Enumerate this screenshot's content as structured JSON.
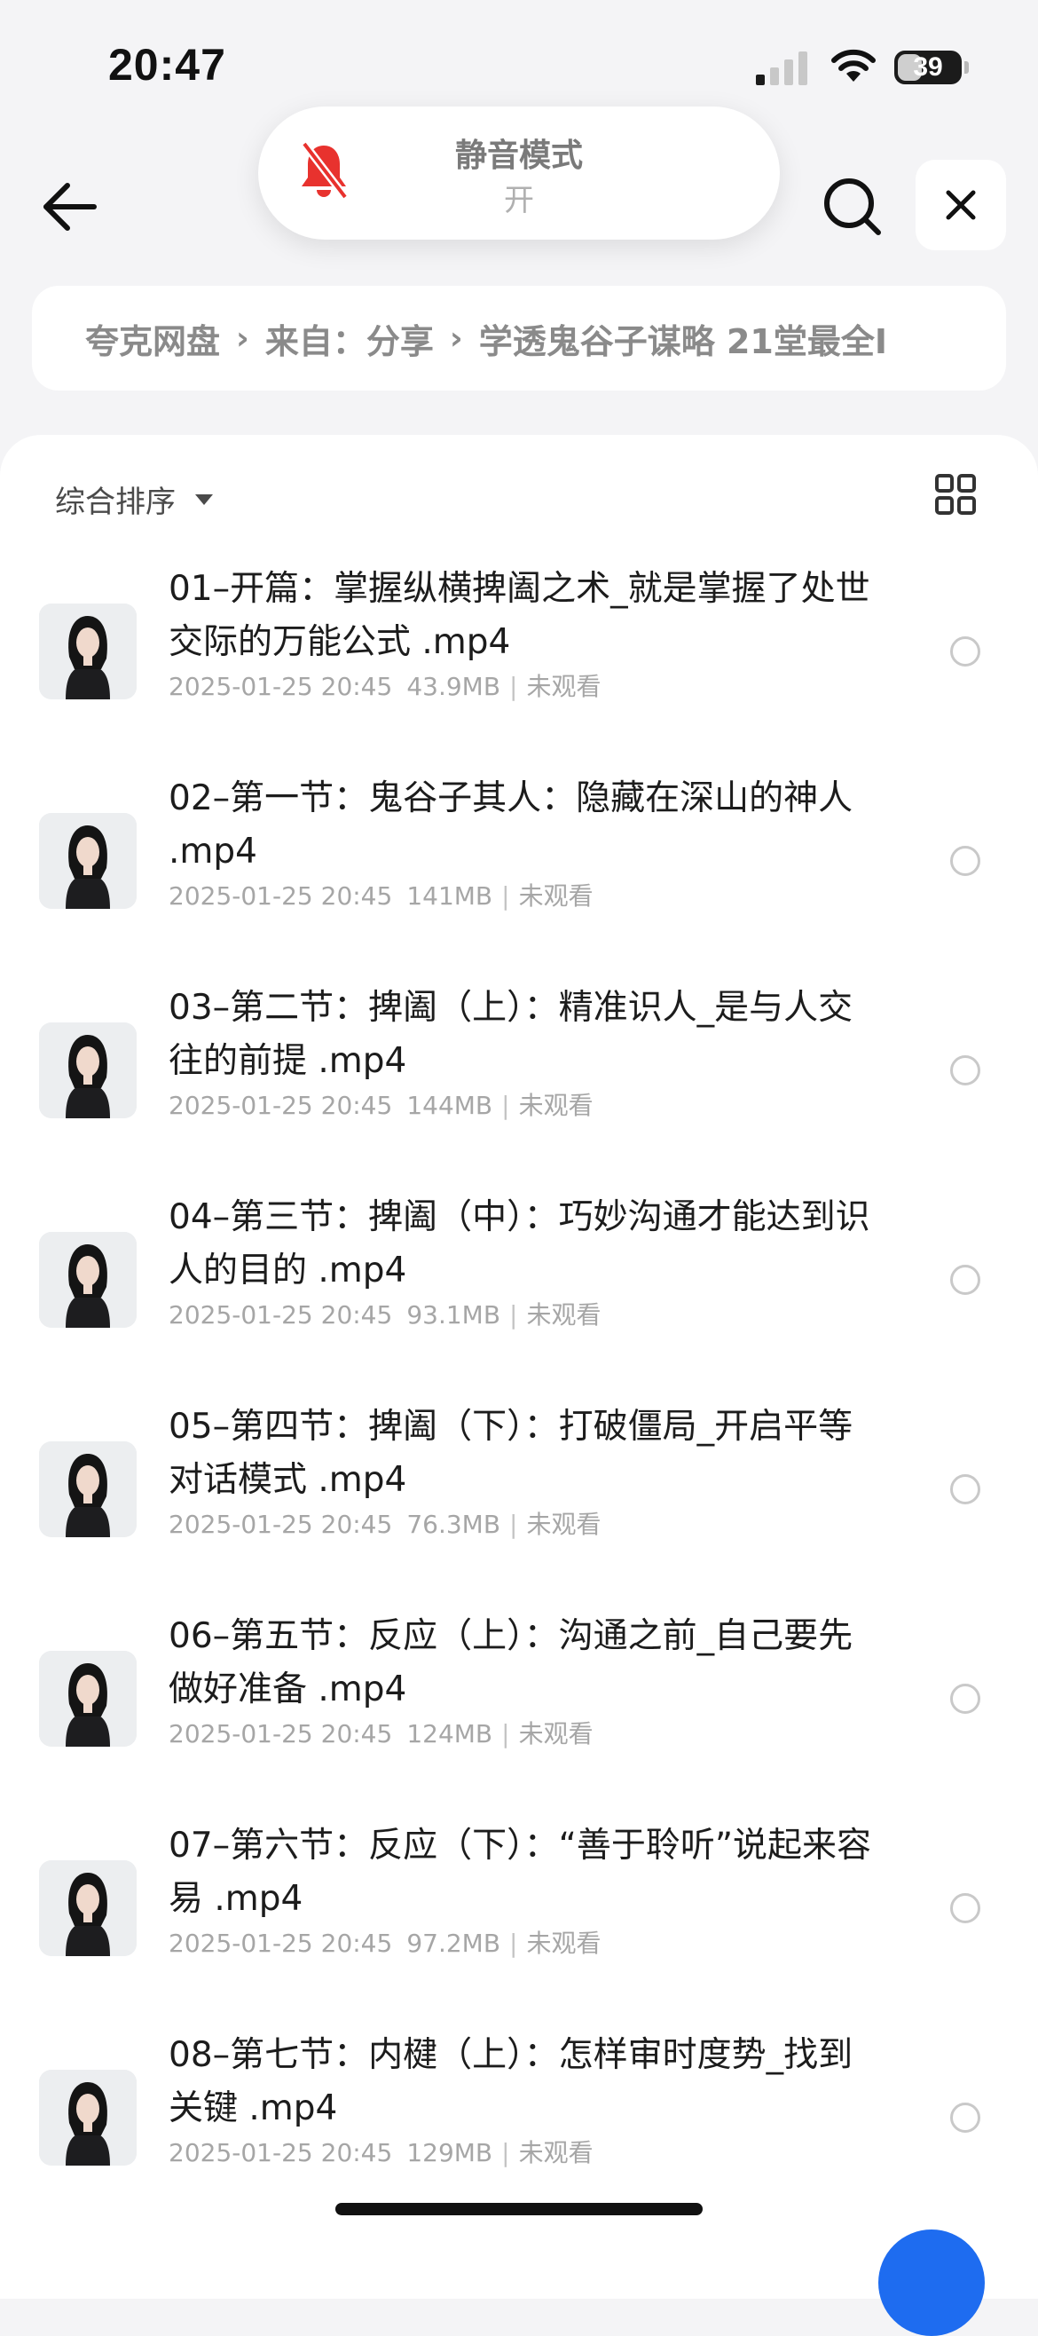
{
  "status_bar": {
    "time": "20:47",
    "battery": "39",
    "battery_level": 0.39
  },
  "silent_mode": {
    "title": "静音模式",
    "state": "开"
  },
  "breadcrumb": {
    "items": [
      "夸克网盘",
      "来自：分享",
      "学透鬼谷子谋略 21堂最全I"
    ]
  },
  "toolbar": {
    "sort_label": "综合排序"
  },
  "files": [
    {
      "name": "01–开篇：掌握纵横捭阖之术_就是掌握了处世交际的万能公式 .mp4",
      "date": "2025-01-25 20:45",
      "size": "43.9MB",
      "status": "未观看"
    },
    {
      "name": "02–第一节：鬼谷子其人：隐藏在深山的神人 .mp4",
      "date": "2025-01-25 20:45",
      "size": "141MB",
      "status": "未观看"
    },
    {
      "name": "03–第二节：捭阖（上）：精准识人_是与人交往的前提 .mp4",
      "date": "2025-01-25 20:45",
      "size": "144MB",
      "status": "未观看"
    },
    {
      "name": "04–第三节：捭阖（中）：巧妙沟通才能达到识人的目的 .mp4",
      "date": "2025-01-25 20:45",
      "size": "93.1MB",
      "status": "未观看"
    },
    {
      "name": "05–第四节：捭阖（下）：打破僵局_开启平等对话模式 .mp4",
      "date": "2025-01-25 20:45",
      "size": "76.3MB",
      "status": "未观看"
    },
    {
      "name": "06–第五节：反应（上）：沟通之前_自己要先做好准备 .mp4",
      "date": "2025-01-25 20:45",
      "size": "124MB",
      "status": "未观看"
    },
    {
      "name": "07–第六节：反应（下）：“善于聆听”说起来容易 .mp4",
      "date": "2025-01-25 20:45",
      "size": "97.2MB",
      "status": "未观看"
    },
    {
      "name": "08–第七节：内楗（上）：怎样审时度势_找到关键 .mp4",
      "date": "2025-01-25 20:45",
      "size": "129MB",
      "status": "未观看"
    }
  ],
  "colors": {
    "accent": "#1e6cf0",
    "silent_bell": "#e8322e",
    "background": "#f4f4f6"
  },
  "icons": [
    "signal-icon",
    "wifi-icon",
    "battery-icon",
    "bell-off-icon",
    "back-arrow-icon",
    "search-icon",
    "close-icon",
    "caret-down-icon",
    "grid-view-icon",
    "radio-icon"
  ]
}
